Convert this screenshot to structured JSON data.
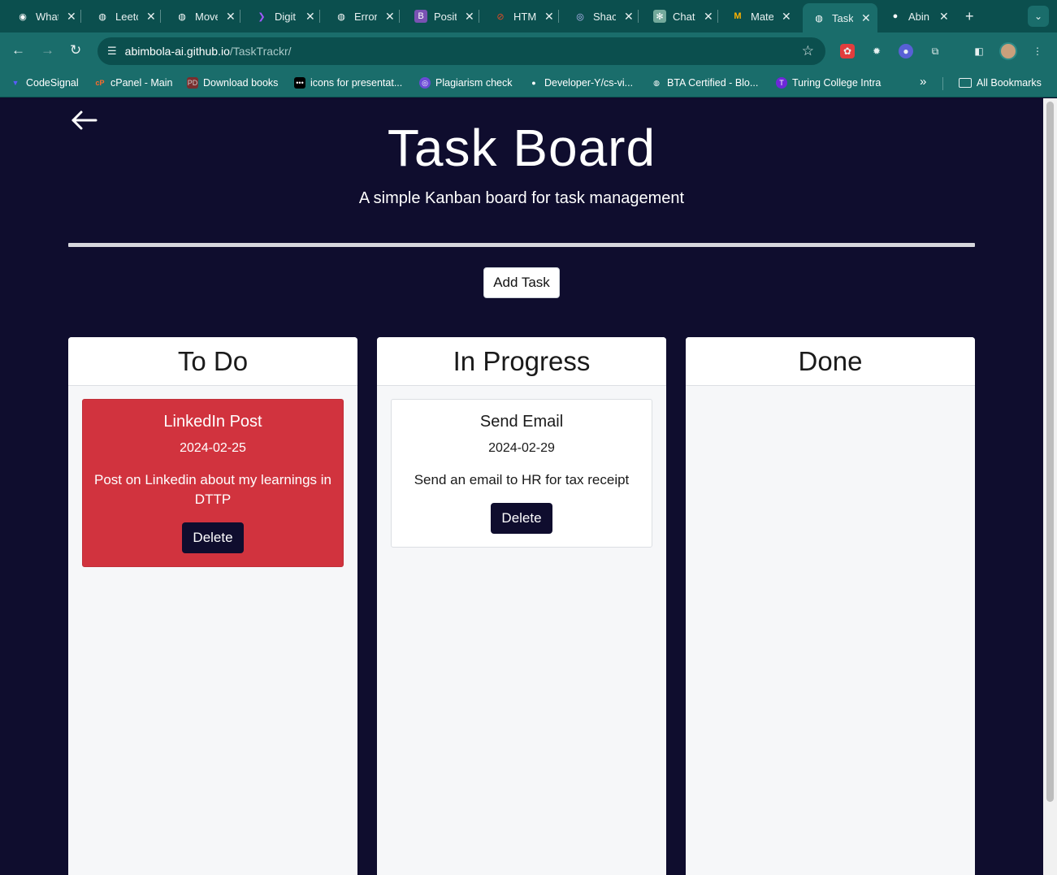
{
  "browser": {
    "tabs": [
      {
        "title": "What",
        "icon": "chrome-icon",
        "active": false
      },
      {
        "title": "Leetc",
        "icon": "globe-icon",
        "active": false
      },
      {
        "title": "Move",
        "icon": "globe-icon",
        "active": false
      },
      {
        "title": "Digit",
        "icon": "digital-logo-icon",
        "active": false
      },
      {
        "title": "Error",
        "icon": "globe-icon",
        "active": false
      },
      {
        "title": "Posit",
        "icon": "bootstrap-icon",
        "active": false
      },
      {
        "title": "HTM",
        "icon": "html-icon",
        "active": false
      },
      {
        "title": "Shac",
        "icon": "shadcn-icon",
        "active": false
      },
      {
        "title": "Chat",
        "icon": "chatgpt-icon",
        "active": false
      },
      {
        "title": "Mate",
        "icon": "material-icon",
        "active": false
      },
      {
        "title": "Task",
        "icon": "globe-icon",
        "active": true
      },
      {
        "title": "Abin",
        "icon": "github-icon",
        "active": false
      }
    ],
    "address": {
      "domain": "abimbola-ai.github.io",
      "path": "/TaskTrackr/"
    },
    "bookmarks": [
      {
        "label": "CodeSignal",
        "icon": "codesignal-icon"
      },
      {
        "label": "cPanel - Main",
        "icon": "cpanel-icon"
      },
      {
        "label": "Download books",
        "icon": "books-icon"
      },
      {
        "label": "icons for presentat...",
        "icon": "dots-icon"
      },
      {
        "label": "Plagiarism check",
        "icon": "plagiarism-icon"
      },
      {
        "label": "Developer-Y/cs-vi...",
        "icon": "github-icon"
      },
      {
        "label": "BTA Certified - Blo...",
        "icon": "globe-icon"
      },
      {
        "label": "Turing College Intra",
        "icon": "turing-icon"
      }
    ],
    "all_bookmarks": "All Bookmarks",
    "overflow": "»"
  },
  "page": {
    "title": "Task Board",
    "subtitle": "A simple Kanban board for task management",
    "add_task": "Add Task",
    "lanes": [
      {
        "name": "To Do",
        "cards": [
          {
            "title": "LinkedIn Post",
            "date": "2024-02-25",
            "description": "Post on Linkedin about my learnings in DTTP",
            "delete": "Delete",
            "style": "danger"
          }
        ]
      },
      {
        "name": "In Progress",
        "cards": [
          {
            "title": "Send Email",
            "date": "2024-02-29",
            "description": "Send an email to HR for tax receipt",
            "delete": "Delete",
            "style": "plain"
          }
        ]
      },
      {
        "name": "Done",
        "cards": []
      }
    ]
  },
  "colors": {
    "page_bg": "#0f0d2e",
    "browser_frame": "#1a6d6b",
    "danger_card": "#d1333e",
    "delete_button": "#0f0d2e"
  }
}
